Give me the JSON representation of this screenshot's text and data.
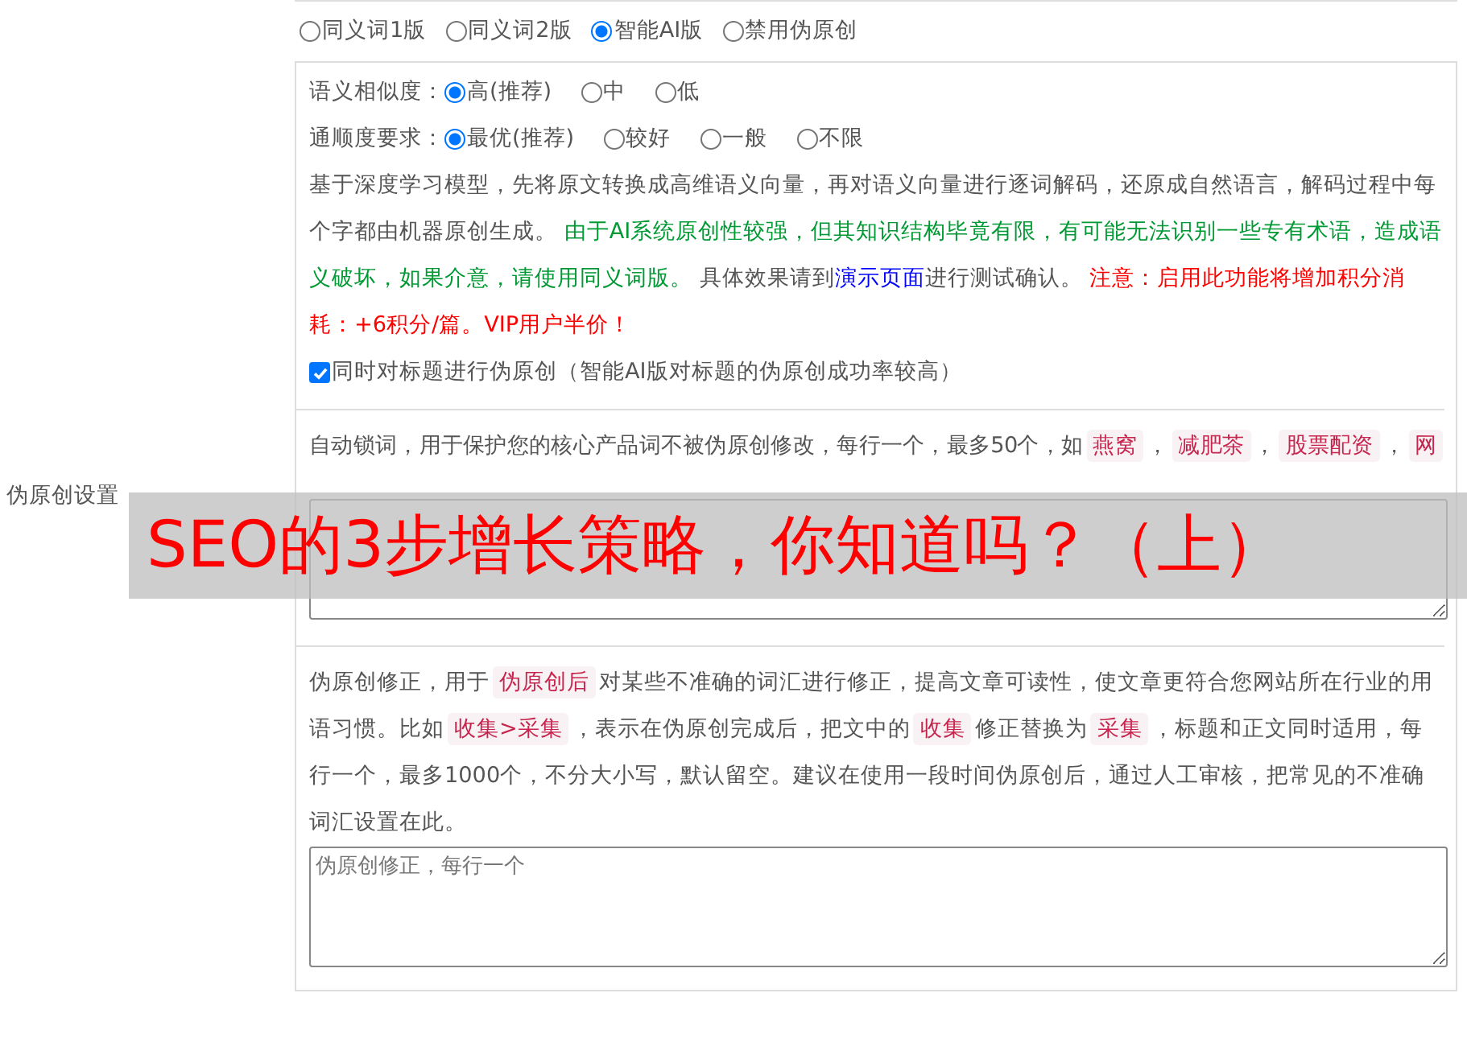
{
  "section_label": "伪原创设置",
  "mode_options": [
    {
      "label": "同义词1版",
      "selected": false
    },
    {
      "label": "同义词2版",
      "selected": false
    },
    {
      "label": "智能AI版",
      "selected": true
    },
    {
      "label": "禁用伪原创",
      "selected": false
    }
  ],
  "settings": [
    {
      "label": "语义相似度：",
      "options": [
        {
          "label": "高(推荐)",
          "selected": true
        },
        {
          "label": "中",
          "selected": false
        },
        {
          "label": "低",
          "selected": false
        }
      ]
    },
    {
      "label": "通顺度要求：",
      "options": [
        {
          "label": "最优(推荐)",
          "selected": true
        },
        {
          "label": "较好",
          "selected": false
        },
        {
          "label": "一般",
          "selected": false
        },
        {
          "label": "不限",
          "selected": false
        }
      ]
    }
  ],
  "description": [
    {
      "kind": "text",
      "text": "基于深度学习模型，先将原文转换成高维语义向量，再对语义向量进行逐词解码，还原成自然语言，解码过程中每个字都由机器原创生成。 "
    },
    {
      "kind": "note",
      "text": "由于AI系统原创性较强，但其知识结构毕竟有限，有可能无法识别一些专有术语，造成语义破坏，如果介意，请使用同义词版。"
    },
    {
      "kind": "text",
      "text": " 具体效果请到"
    },
    {
      "kind": "link",
      "text": "演示页面"
    },
    {
      "kind": "text",
      "text": "进行测试确认。 "
    },
    {
      "kind": "warning",
      "text": "注意：启用此功能将增加积分消耗：+6积分/篇。VIP用户半价！"
    }
  ],
  "title_checkbox": {
    "label": "同时对标题进行伪原创（智能AI版对标题的伪原创成功率较高）",
    "checked": true
  },
  "lock_words": {
    "description": [
      {
        "kind": "text",
        "text": "自动锁词，用于保护您的核心产品词不被伪原创修改，每行一个，最多50个，如"
      },
      {
        "kind": "code",
        "text": "燕窝"
      },
      {
        "kind": "text",
        "text": "，"
      },
      {
        "kind": "code",
        "text": "减肥茶"
      },
      {
        "kind": "text",
        "text": "，"
      },
      {
        "kind": "code",
        "text": "股票配资"
      },
      {
        "kind": "text",
        "text": "，"
      },
      {
        "kind": "code",
        "text": "网"
      }
    ]
  },
  "correction": {
    "description": [
      {
        "kind": "text",
        "text": "伪原创修正，用于"
      },
      {
        "kind": "code",
        "text": "伪原创后"
      },
      {
        "kind": "text",
        "text": "对某些不准确的词汇进行修正，提高文章可读性，使文章更符合您网站所在行业的用语习惯。比如"
      },
      {
        "kind": "code",
        "text": "收集>采集"
      },
      {
        "kind": "text",
        "text": "，表示在伪原创完成后，把文中的"
      },
      {
        "kind": "code",
        "text": "收集"
      },
      {
        "kind": "text",
        "text": "修正替换为"
      },
      {
        "kind": "code",
        "text": "采集"
      },
      {
        "kind": "text",
        "text": "，标题和正文同时适用，每行一个，最多1000个，不分大小写，默认留空。建议在使用一段时间伪原创后，通过人工审核，把常见的不准确词汇设置在此。"
      }
    ],
    "placeholder": "伪原创修正，每行一个"
  },
  "overlay_banner": "SEO的3步增长策略，你知道吗？（上）"
}
